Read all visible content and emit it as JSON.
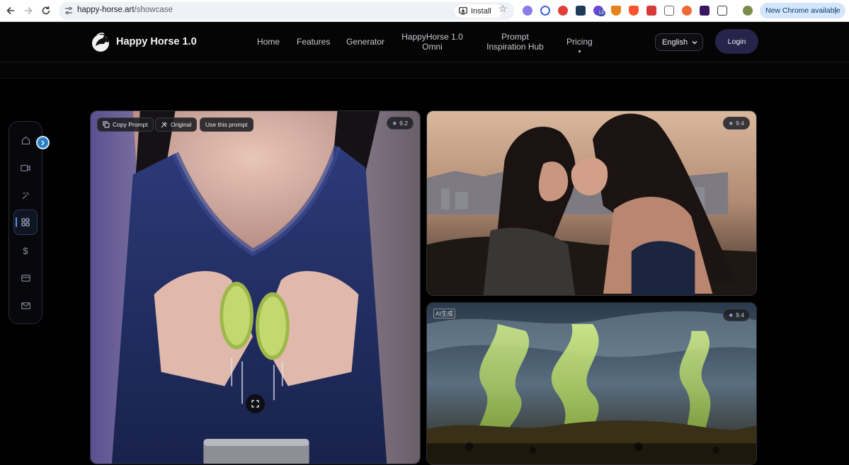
{
  "browser": {
    "url_host": "happy-horse.art",
    "url_path": "/showcase",
    "install_label": "Install",
    "update_label": "New Chrome available",
    "extension_badge": "13"
  },
  "header": {
    "brand": "Happy Horse 1.0",
    "nav": [
      {
        "line1": "Home",
        "line2": ""
      },
      {
        "line1": "Features",
        "line2": ""
      },
      {
        "line1": "Generator",
        "line2": ""
      },
      {
        "line1": "HappyHorse 1.0",
        "line2": "Omni"
      },
      {
        "line1": "Prompt",
        "line2": "Inspiration Hub"
      },
      {
        "line1": "Pricing",
        "line2": ""
      }
    ],
    "language": "English",
    "login": "Login"
  },
  "sidebar": {
    "items": [
      "home-icon",
      "video-icon",
      "sparkle-icon",
      "grid-icon",
      "dollar-icon",
      "card-icon",
      "mail-icon"
    ],
    "active_index": 3
  },
  "gallery": {
    "featured": {
      "actions": [
        "Copy Prompt",
        "Original",
        "Use this prompt"
      ],
      "score": "9.2"
    },
    "card_top_right": {
      "score": "9.4"
    },
    "card_bottom_right": {
      "score": "9.4",
      "tag": "AI生成"
    }
  },
  "colors": {
    "accent": "#5b8fe6",
    "login_bg": "#26244a",
    "background": "#000000"
  }
}
